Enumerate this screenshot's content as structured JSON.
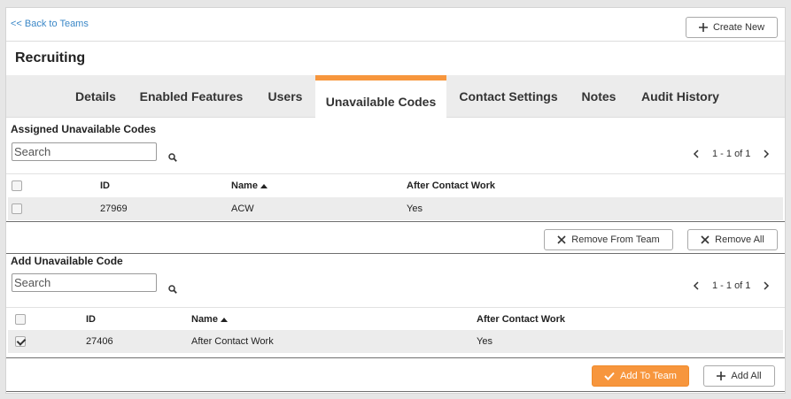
{
  "header": {
    "back_link": "<< Back to Teams",
    "create_new_label": "Create New",
    "page_title": "Recruiting"
  },
  "tabs": [
    {
      "label": "Details"
    },
    {
      "label": "Enabled Features"
    },
    {
      "label": "Users"
    },
    {
      "label": "Unavailable Codes",
      "active": true
    },
    {
      "label": "Contact Settings"
    },
    {
      "label": "Notes"
    },
    {
      "label": "Audit History"
    }
  ],
  "assigned": {
    "title": "Assigned Unavailable Codes",
    "search_placeholder": "Search",
    "pager_range": "1 - 1 of 1",
    "columns": [
      "ID",
      "Name",
      "After Contact Work"
    ],
    "rows": [
      {
        "id": "27969",
        "name": "ACW",
        "acw": "Yes",
        "checked": false
      }
    ],
    "remove_label": "Remove From Team",
    "remove_all_label": "Remove All"
  },
  "available": {
    "title": "Add Unavailable Code",
    "search_placeholder": "Search",
    "pager_range": "1 - 1 of 1",
    "columns": [
      "ID",
      "Name",
      "After Contact Work"
    ],
    "rows": [
      {
        "id": "27406",
        "name": "After Contact Work",
        "acw": "Yes",
        "checked": true
      }
    ],
    "add_label": "Add To Team",
    "add_all_label": "Add All"
  },
  "colors": {
    "accent": "#f7963d",
    "link": "#3a87c7"
  }
}
